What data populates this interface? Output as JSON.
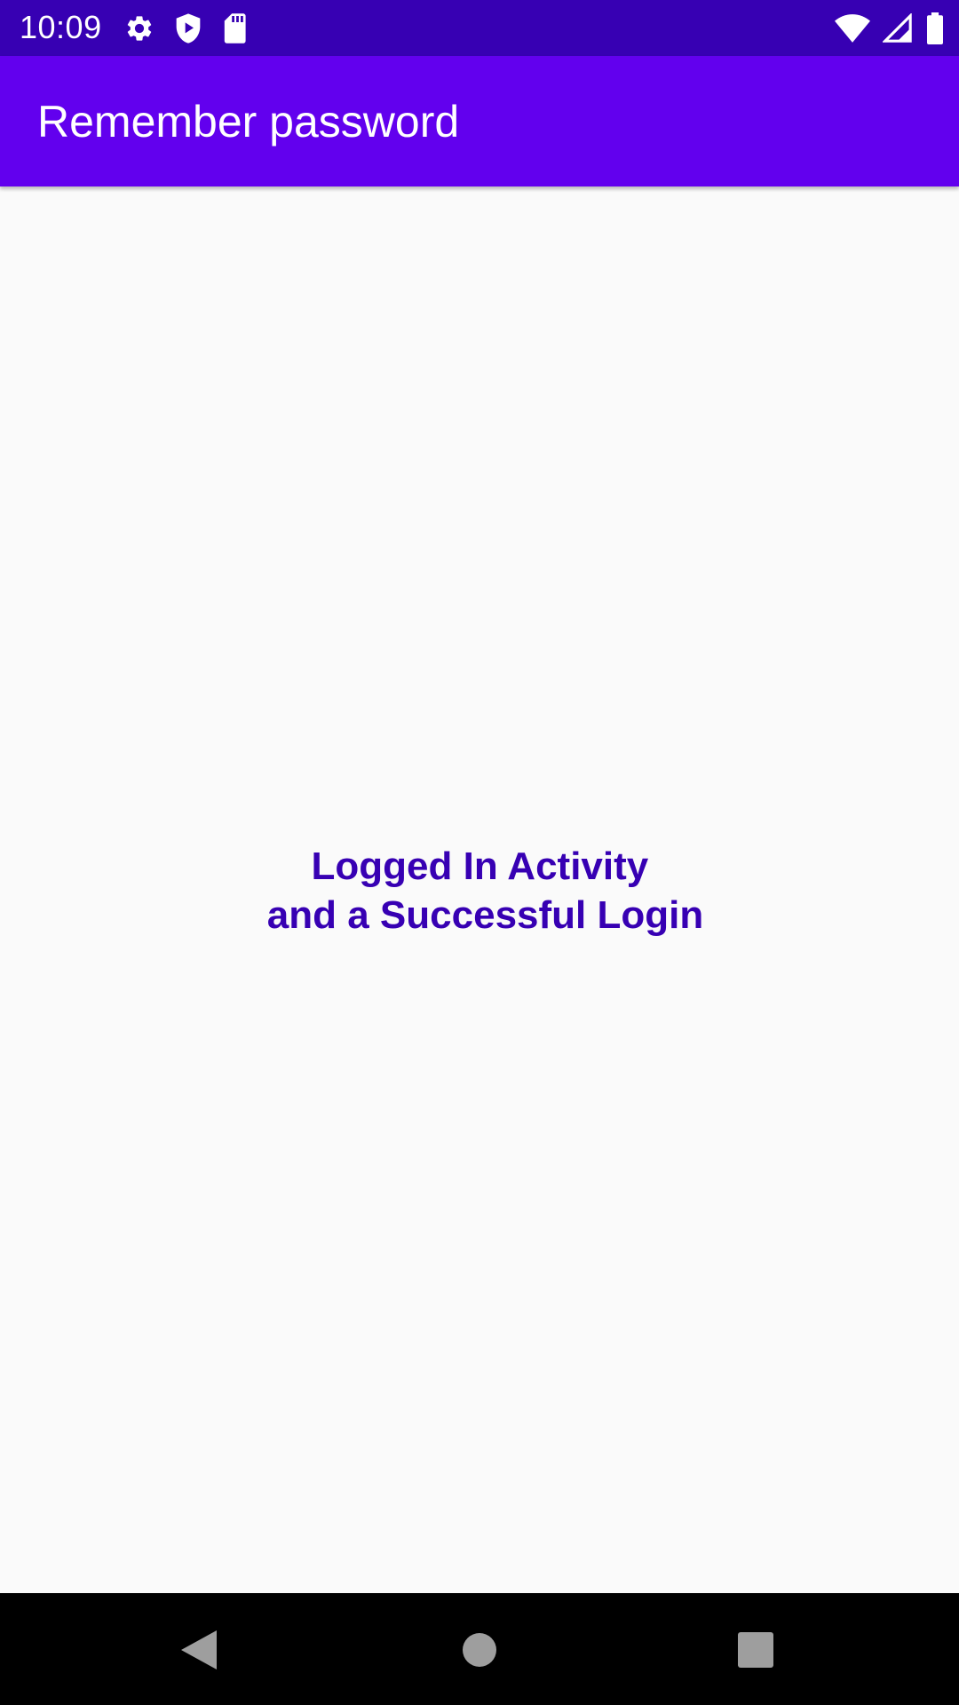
{
  "status_bar": {
    "time": "10:09",
    "left_icons": [
      "gear-icon",
      "shield-play-icon",
      "sd-card-icon"
    ],
    "right_icons": [
      "wifi-icon",
      "cell-signal-icon",
      "battery-icon"
    ]
  },
  "app_bar": {
    "title": "Remember password",
    "color": "#6200ee"
  },
  "main": {
    "message": "Logged In Activity \nand a Successful Login",
    "message_color": "#3700b3"
  },
  "nav_bar": {
    "buttons": [
      "back-icon",
      "home-icon",
      "recents-icon"
    ]
  },
  "colors": {
    "status_bar": "#3700b3",
    "app_bar": "#6200ee",
    "background": "#fafafa",
    "nav_bar": "#000000"
  }
}
